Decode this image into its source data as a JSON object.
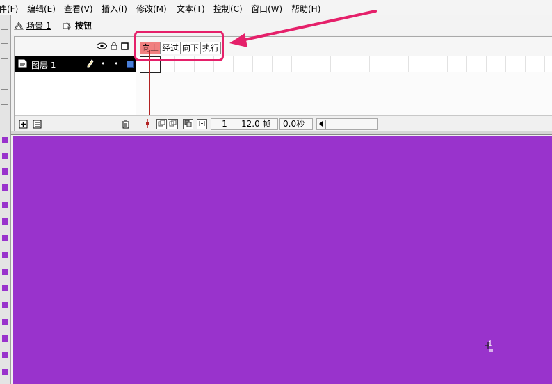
{
  "menu": [
    "件(F)",
    "编辑(E)",
    "查看(V)",
    "插入(I)",
    "修改(M)",
    "文本(T)",
    "控制(C)",
    "窗口(W)",
    "帮助(H)"
  ],
  "scene": {
    "scene_label": "场景 1",
    "symbol_label": "按钮"
  },
  "timeline": {
    "frame_labels": [
      "向上",
      "经过",
      "向下",
      "执行"
    ],
    "layer": {
      "name": "图层 1",
      "color": "#4a7fd8"
    },
    "footer": {
      "frame": "1",
      "fps": "12.0 帧",
      "time": "0.0秒"
    }
  },
  "stage": {
    "background": "#9933cc"
  },
  "annotation": {
    "color": "#e5206a"
  },
  "icons": [
    "scene-icon",
    "button-symbol-icon",
    "eye-icon",
    "lock-icon",
    "outline-icon",
    "layer-icon",
    "pencil-icon",
    "add-layer-icon",
    "add-folder-icon",
    "trash-icon",
    "center-frame-icon",
    "onion-skin-icon",
    "onion-outline-icon",
    "edit-multiple-icon",
    "onion-markers-icon",
    "registration-point-icon"
  ]
}
